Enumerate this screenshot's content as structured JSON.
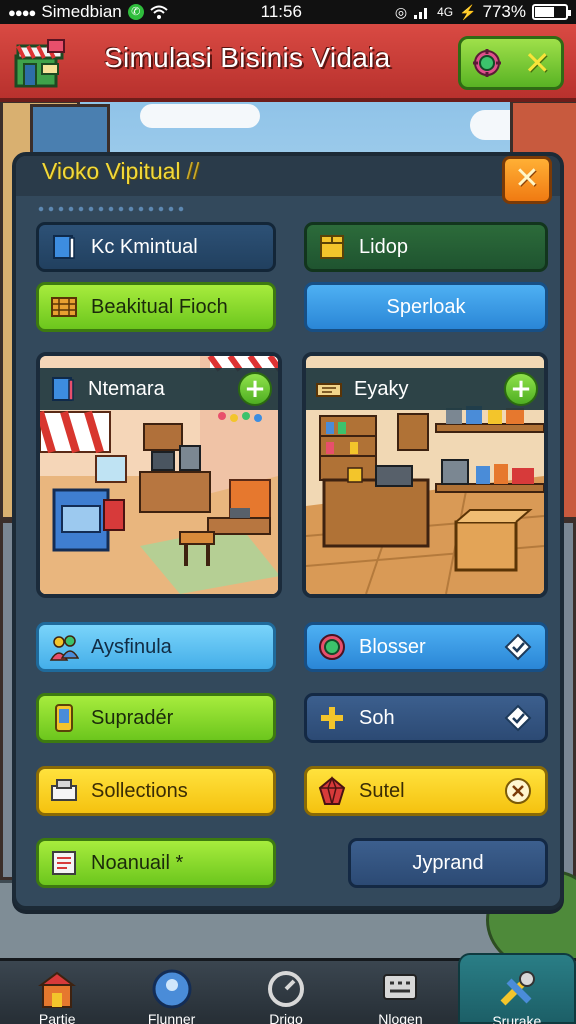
{
  "status_bar": {
    "carrier": "Simedbian",
    "time": "11:56",
    "battery": "773%"
  },
  "header": {
    "title": "Simulasi Bisinis Vidaia"
  },
  "panel": {
    "title": "Vioko Vipitual",
    "title_mark": "//"
  },
  "top_buttons": [
    {
      "label": "Kc Kmintual",
      "icon": "book-icon",
      "style": "navy"
    },
    {
      "label": "Lidop",
      "icon": "box-icon",
      "style": "darkgreen"
    },
    {
      "label": "Beakitual Fioch",
      "icon": "crate-icon",
      "style": "green"
    },
    {
      "label": "Sperloak",
      "icon": "",
      "style": "blue"
    }
  ],
  "cards": [
    {
      "label": "Ntemara",
      "icon": "book-icon",
      "action": "+"
    },
    {
      "label": "Eyaky",
      "icon": "scroll-icon",
      "action": "+"
    }
  ],
  "grid_buttons": [
    {
      "label": "Aysfinula",
      "icon": "people-icon",
      "style": "sky"
    },
    {
      "label": "Blosser",
      "icon": "coin-icon",
      "style": "blue",
      "trail": "diamond-check-icon"
    },
    {
      "label": "Supradér",
      "icon": "phone-icon",
      "style": "green"
    },
    {
      "label": "Soh",
      "icon": "plus-icon",
      "style": "steel",
      "trail": "diamond-check-icon"
    },
    {
      "label": "Sollections",
      "icon": "register-icon",
      "style": "yellow"
    },
    {
      "label": "Sutel",
      "icon": "crystal-icon",
      "style": "yellow",
      "trail": "close-circle-icon"
    },
    {
      "label": "Noanuail *",
      "icon": "ledger-icon",
      "style": "green"
    },
    {
      "label": "Jyprand",
      "icon": "",
      "style": "steel"
    }
  ],
  "bottom_nav": [
    {
      "label": "Partie",
      "icon": "shop-icon"
    },
    {
      "label": "Flunner",
      "icon": "pin-icon"
    },
    {
      "label": "Drigo",
      "icon": "clock-icon"
    },
    {
      "label": "Nlogen",
      "icon": "chat-icon"
    },
    {
      "label": "Srurake",
      "icon": "tools-icon",
      "active": true
    }
  ],
  "colors": {
    "header_red": "#c23a34",
    "panel_bg": "#33495c",
    "accent_green": "#7fd22a",
    "accent_yellow": "#f7d12a",
    "accent_orange": "#f28c1a"
  }
}
